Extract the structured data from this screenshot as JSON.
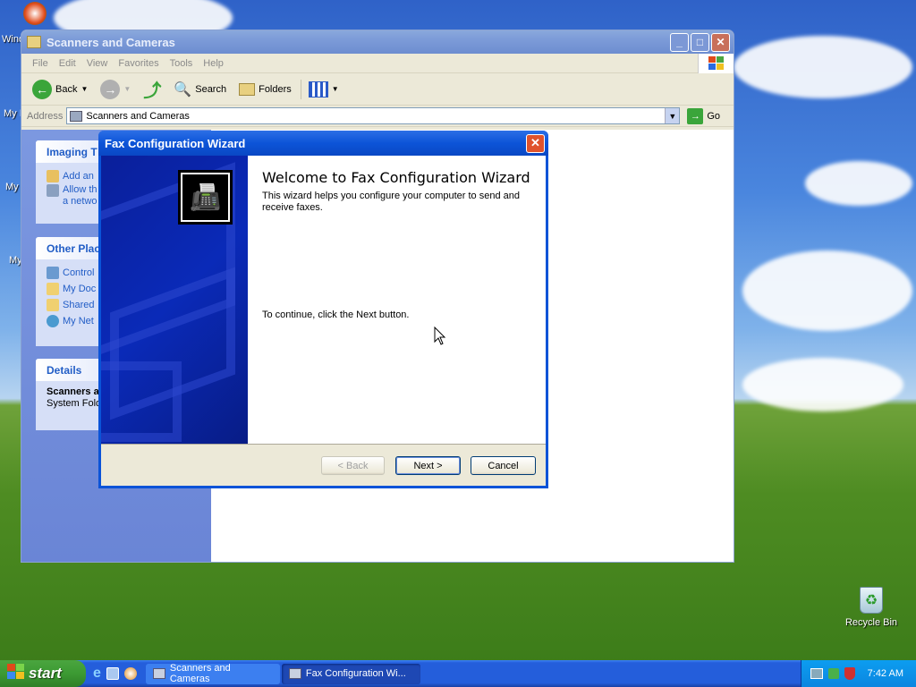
{
  "desktop": {
    "icons": [
      {
        "label": "Wind"
      },
      {
        "label": "My I"
      },
      {
        "label": "My"
      },
      {
        "label": "My"
      }
    ],
    "recycle_bin": {
      "label": "Recycle Bin"
    }
  },
  "explorer": {
    "title": "Scanners and Cameras",
    "menu": [
      "File",
      "Edit",
      "View",
      "Favorites",
      "Tools",
      "Help"
    ],
    "toolbar": {
      "back": "Back",
      "search": "Search",
      "folders": "Folders"
    },
    "address": {
      "label": "Address",
      "value": "Scanners and Cameras",
      "go": "Go"
    },
    "panels": {
      "imaging": {
        "title": "Imaging T",
        "items": [
          "Add an",
          "Allow th\na netwo"
        ]
      },
      "other": {
        "title": "Other Plac",
        "items": [
          "Control",
          "My Doc",
          "Shared",
          "My Net"
        ]
      },
      "details": {
        "title": "Details",
        "name": "Scanners a",
        "type": "System Fold"
      }
    }
  },
  "wizard": {
    "title": "Fax Configuration Wizard",
    "heading": "Welcome to Fax Configuration Wizard",
    "description": "This wizard helps you configure your computer to send and receive faxes.",
    "continue_text": "To continue, click the Next button.",
    "buttons": {
      "back": "< Back",
      "next": "Next >",
      "cancel": "Cancel"
    }
  },
  "taskbar": {
    "start": "start",
    "tasks": [
      {
        "label": "Scanners and Cameras",
        "active": false
      },
      {
        "label": "Fax Configuration Wi...",
        "active": true
      }
    ],
    "clock": "7:42 AM"
  },
  "colors": {
    "accent": "#0a53d8",
    "link": "#215dc6"
  }
}
